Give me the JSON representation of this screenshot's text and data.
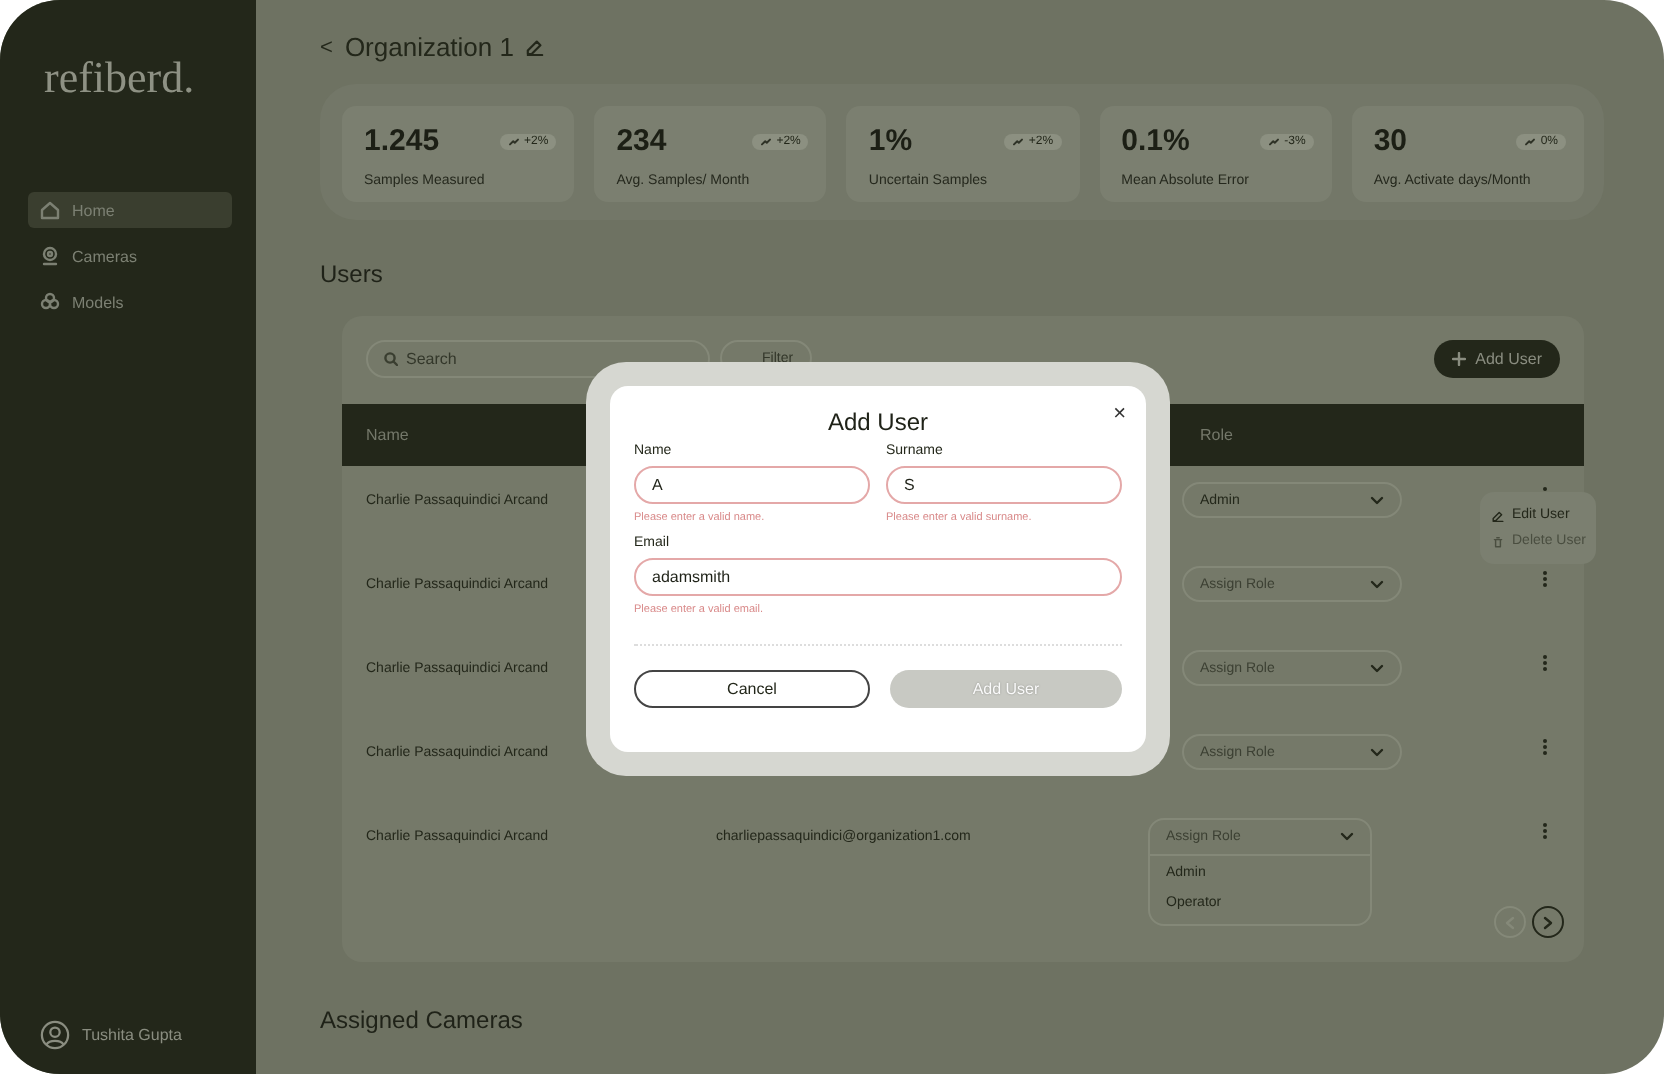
{
  "sidebar": {
    "logo": "refiberd.",
    "nav": [
      {
        "label": "Home",
        "selected": true
      },
      {
        "label": "Cameras",
        "selected": false
      },
      {
        "label": "Models",
        "selected": false
      }
    ],
    "user": "Tushita Gupta"
  },
  "header": {
    "back": "<",
    "title": "Organization 1"
  },
  "stats": [
    {
      "value": "1.245",
      "label": "Samples Measured",
      "change": "+2%"
    },
    {
      "value": "234",
      "label": "Avg. Samples/ Month",
      "change": "+2%"
    },
    {
      "value": "1%",
      "label": "Uncertain Samples",
      "change": "+2%"
    },
    {
      "value": "0.1%",
      "label": "Mean Absolute Error",
      "change": "-3%"
    },
    {
      "value": "30",
      "label": "Avg. Activate days/Month",
      "change": "0%"
    }
  ],
  "users": {
    "title": "Users",
    "search": {
      "placeholder": "Search"
    },
    "filter_button": "Filter",
    "add_button": "Add User",
    "table": {
      "name_column": "Name",
      "role_column": "Role",
      "rows": [
        {
          "name": "Charlie Passaquindici Arcand",
          "role": "Admin",
          "menu_open": true
        },
        {
          "name": "Charlie Passaquindici Arcand",
          "role_placeholder": "Assign Role",
          "menu_open": false
        },
        {
          "name": "Charlie Passaquindici Arcand",
          "role_placeholder": "Assign Role",
          "menu_open": false
        },
        {
          "name": "Charlie Passaquindici Arcand",
          "role_placeholder": "Assign Role",
          "menu_open": false
        },
        {
          "name": "Charlie Passaquindici Arcand",
          "email": "charliepassaquindici@organization1.com",
          "role_placeholder": "Assign Role",
          "menu_open": false,
          "role_options": [
            "Admin",
            "Operator"
          ]
        }
      ]
    },
    "row_menu": [
      {
        "label": "Edit User",
        "disabled": false
      },
      {
        "label": "Delete User",
        "disabled": true
      }
    ],
    "pagination": {
      "prev_disabled": true,
      "next_disabled": false
    }
  },
  "assigned_cameras": {
    "title": "Assigned Cameras"
  },
  "dialog": {
    "title": "Add User",
    "close": "×",
    "fields": [
      {
        "label": "Name",
        "value": "A",
        "error": "Please enter a valid name.",
        "invalid": true
      },
      {
        "label": "Surname",
        "value": "S",
        "error": "Please enter a valid surname.",
        "invalid": true
      },
      {
        "label": "Email",
        "value": "adamsmith",
        "error": "Please enter a valid email.",
        "invalid": true
      }
    ],
    "cancel_button": "Cancel",
    "submit_button": {
      "label": "Add User",
      "disabled": true
    }
  }
}
